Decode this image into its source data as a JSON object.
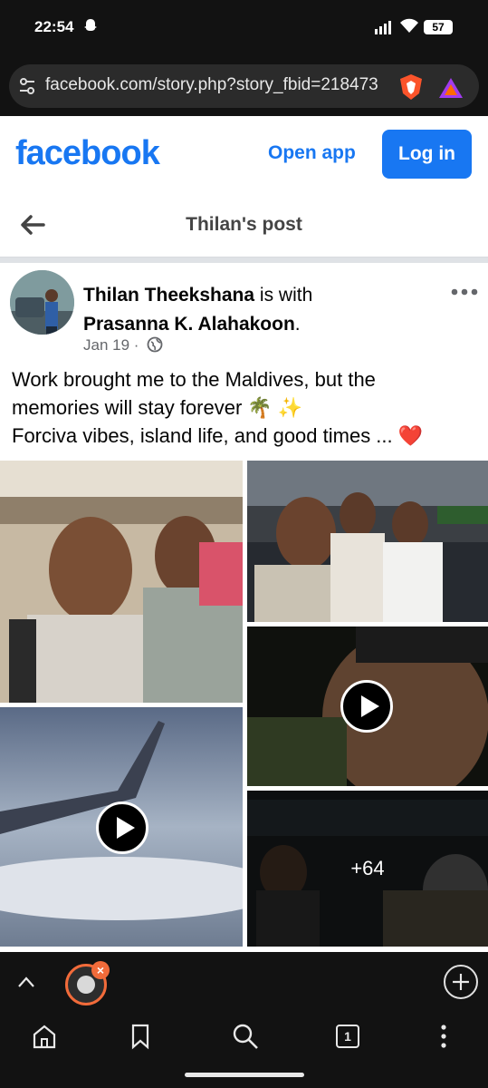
{
  "status": {
    "time": "22:54",
    "battery": "57"
  },
  "browser": {
    "url": "facebook.com/story.php?story_fbid=218473"
  },
  "fb": {
    "logo": "facebook",
    "open_app": "Open app",
    "log_in": "Log in"
  },
  "post_header": {
    "title": "Thilan's post"
  },
  "post": {
    "author": "Thilan Theekshana",
    "with_text": " is with ",
    "tagged": "Prasanna K. Alahakoon",
    "period": ".",
    "date": "Jan 19",
    "dot": " · ",
    "caption_line1": "Work brought me to the Maldives, but the",
    "caption_line2": "memories will stay forever 🌴 ✨",
    "caption_line3": "Forciva vibes, island life, and good times ... ❤️",
    "more_count": "+64"
  },
  "tabs": {
    "count": "1"
  },
  "colors": {
    "brand": "#1877f2",
    "tab_accent": "#f26b3a"
  }
}
